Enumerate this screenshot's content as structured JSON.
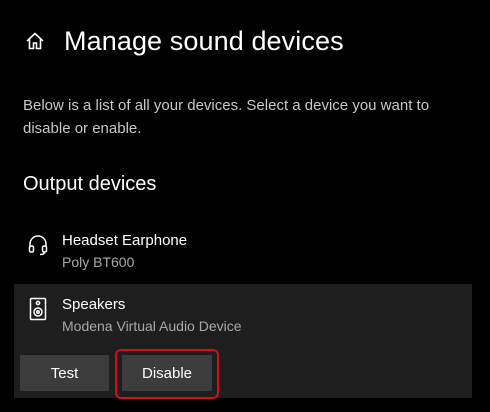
{
  "header": {
    "home_icon": "home-icon",
    "title": "Manage sound devices"
  },
  "description": "Below is a list of all your devices. Select a device you want to disable or enable.",
  "output_section": {
    "title": "Output devices",
    "devices": [
      {
        "icon": "headset-icon",
        "name": "Headset Earphone",
        "subtitle": "Poly BT600",
        "selected": false
      },
      {
        "icon": "speaker-icon",
        "name": "Speakers",
        "subtitle": "Modena Virtual Audio Device",
        "selected": true
      }
    ],
    "buttons": {
      "test_label": "Test",
      "disable_label": "Disable"
    }
  },
  "colors": {
    "background": "#000000",
    "selected_row": "#1e1e1e",
    "button": "#3c3c3c",
    "highlight_outline": "#d40d1c"
  }
}
